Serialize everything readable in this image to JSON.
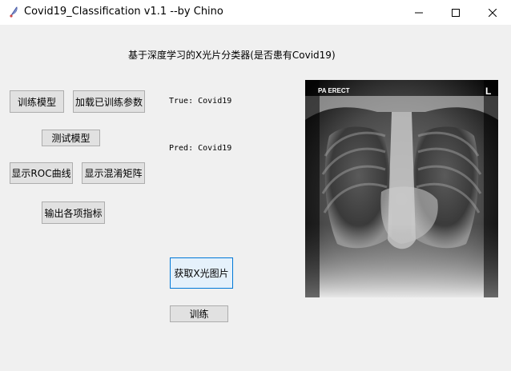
{
  "window": {
    "title": "Covid19_Classification v1.1 --by Chino",
    "icon": "app-feather-icon",
    "controls": [
      "minimize-icon",
      "maximize-icon",
      "close-icon"
    ]
  },
  "main": {
    "heading": "基于深度学习的X光片分类器(是否患有Covid19)",
    "true_label": "True: Covid19",
    "pred_label": "Pred: Covid19"
  },
  "buttons": {
    "train_model": "训练模型",
    "load_params": "加载已训练参数",
    "test_model": "测试模型",
    "show_roc": "显示ROC曲线",
    "show_confusion": "显示混淆矩阵",
    "output_metrics": "输出各项指标",
    "get_xray": "获取X光图片",
    "train": "训练"
  },
  "xray": {
    "top_left_label": "PA ERECT",
    "top_right_label": "L"
  }
}
